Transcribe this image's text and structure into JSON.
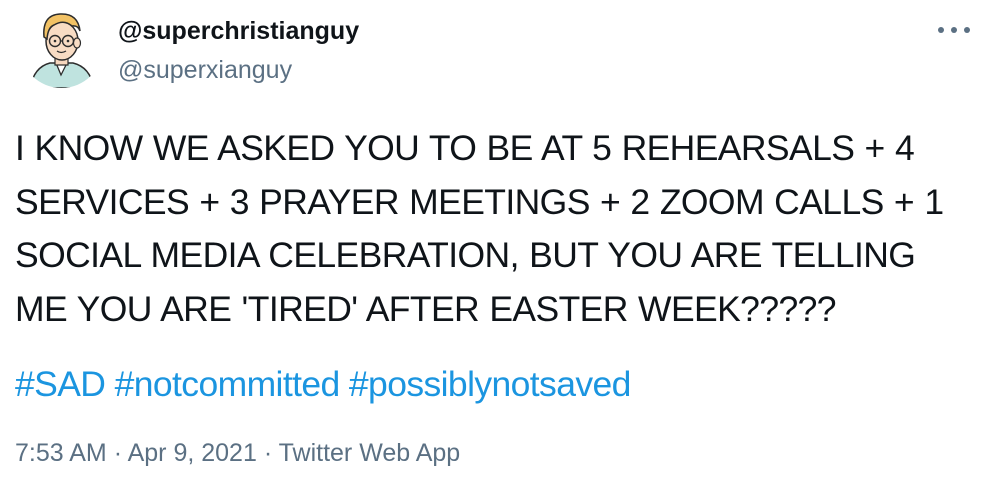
{
  "author": {
    "display_name": "@superchristianguy",
    "handle": "@superxianguy",
    "avatar_icon": "cartoon-man-avatar-icon"
  },
  "menu": {
    "more_icon": "more-dots-icon"
  },
  "tweet": {
    "lines": [
      "I KNOW WE ASKED YOU TO BE AT 5 REHEARSALS + 4",
      "SERVICES + 3 PRAYER MEETINGS + 2 ZOOM CALLS + 1",
      "SOCIAL MEDIA CELEBRATION, BUT YOU ARE TELLING",
      "ME YOU ARE 'TIRED' AFTER EASTER WEEK?????"
    ],
    "hashtags": [
      "#SAD",
      "#notcommitted",
      "#possiblynotsaved"
    ]
  },
  "meta": {
    "time": "7:53 AM",
    "separator": "·",
    "date": "Apr 9, 2021",
    "source": "Twitter Web App"
  },
  "colors": {
    "text": "#0f1419",
    "secondary": "#5b7083",
    "link": "#1b95e0",
    "background": "#ffffff"
  }
}
